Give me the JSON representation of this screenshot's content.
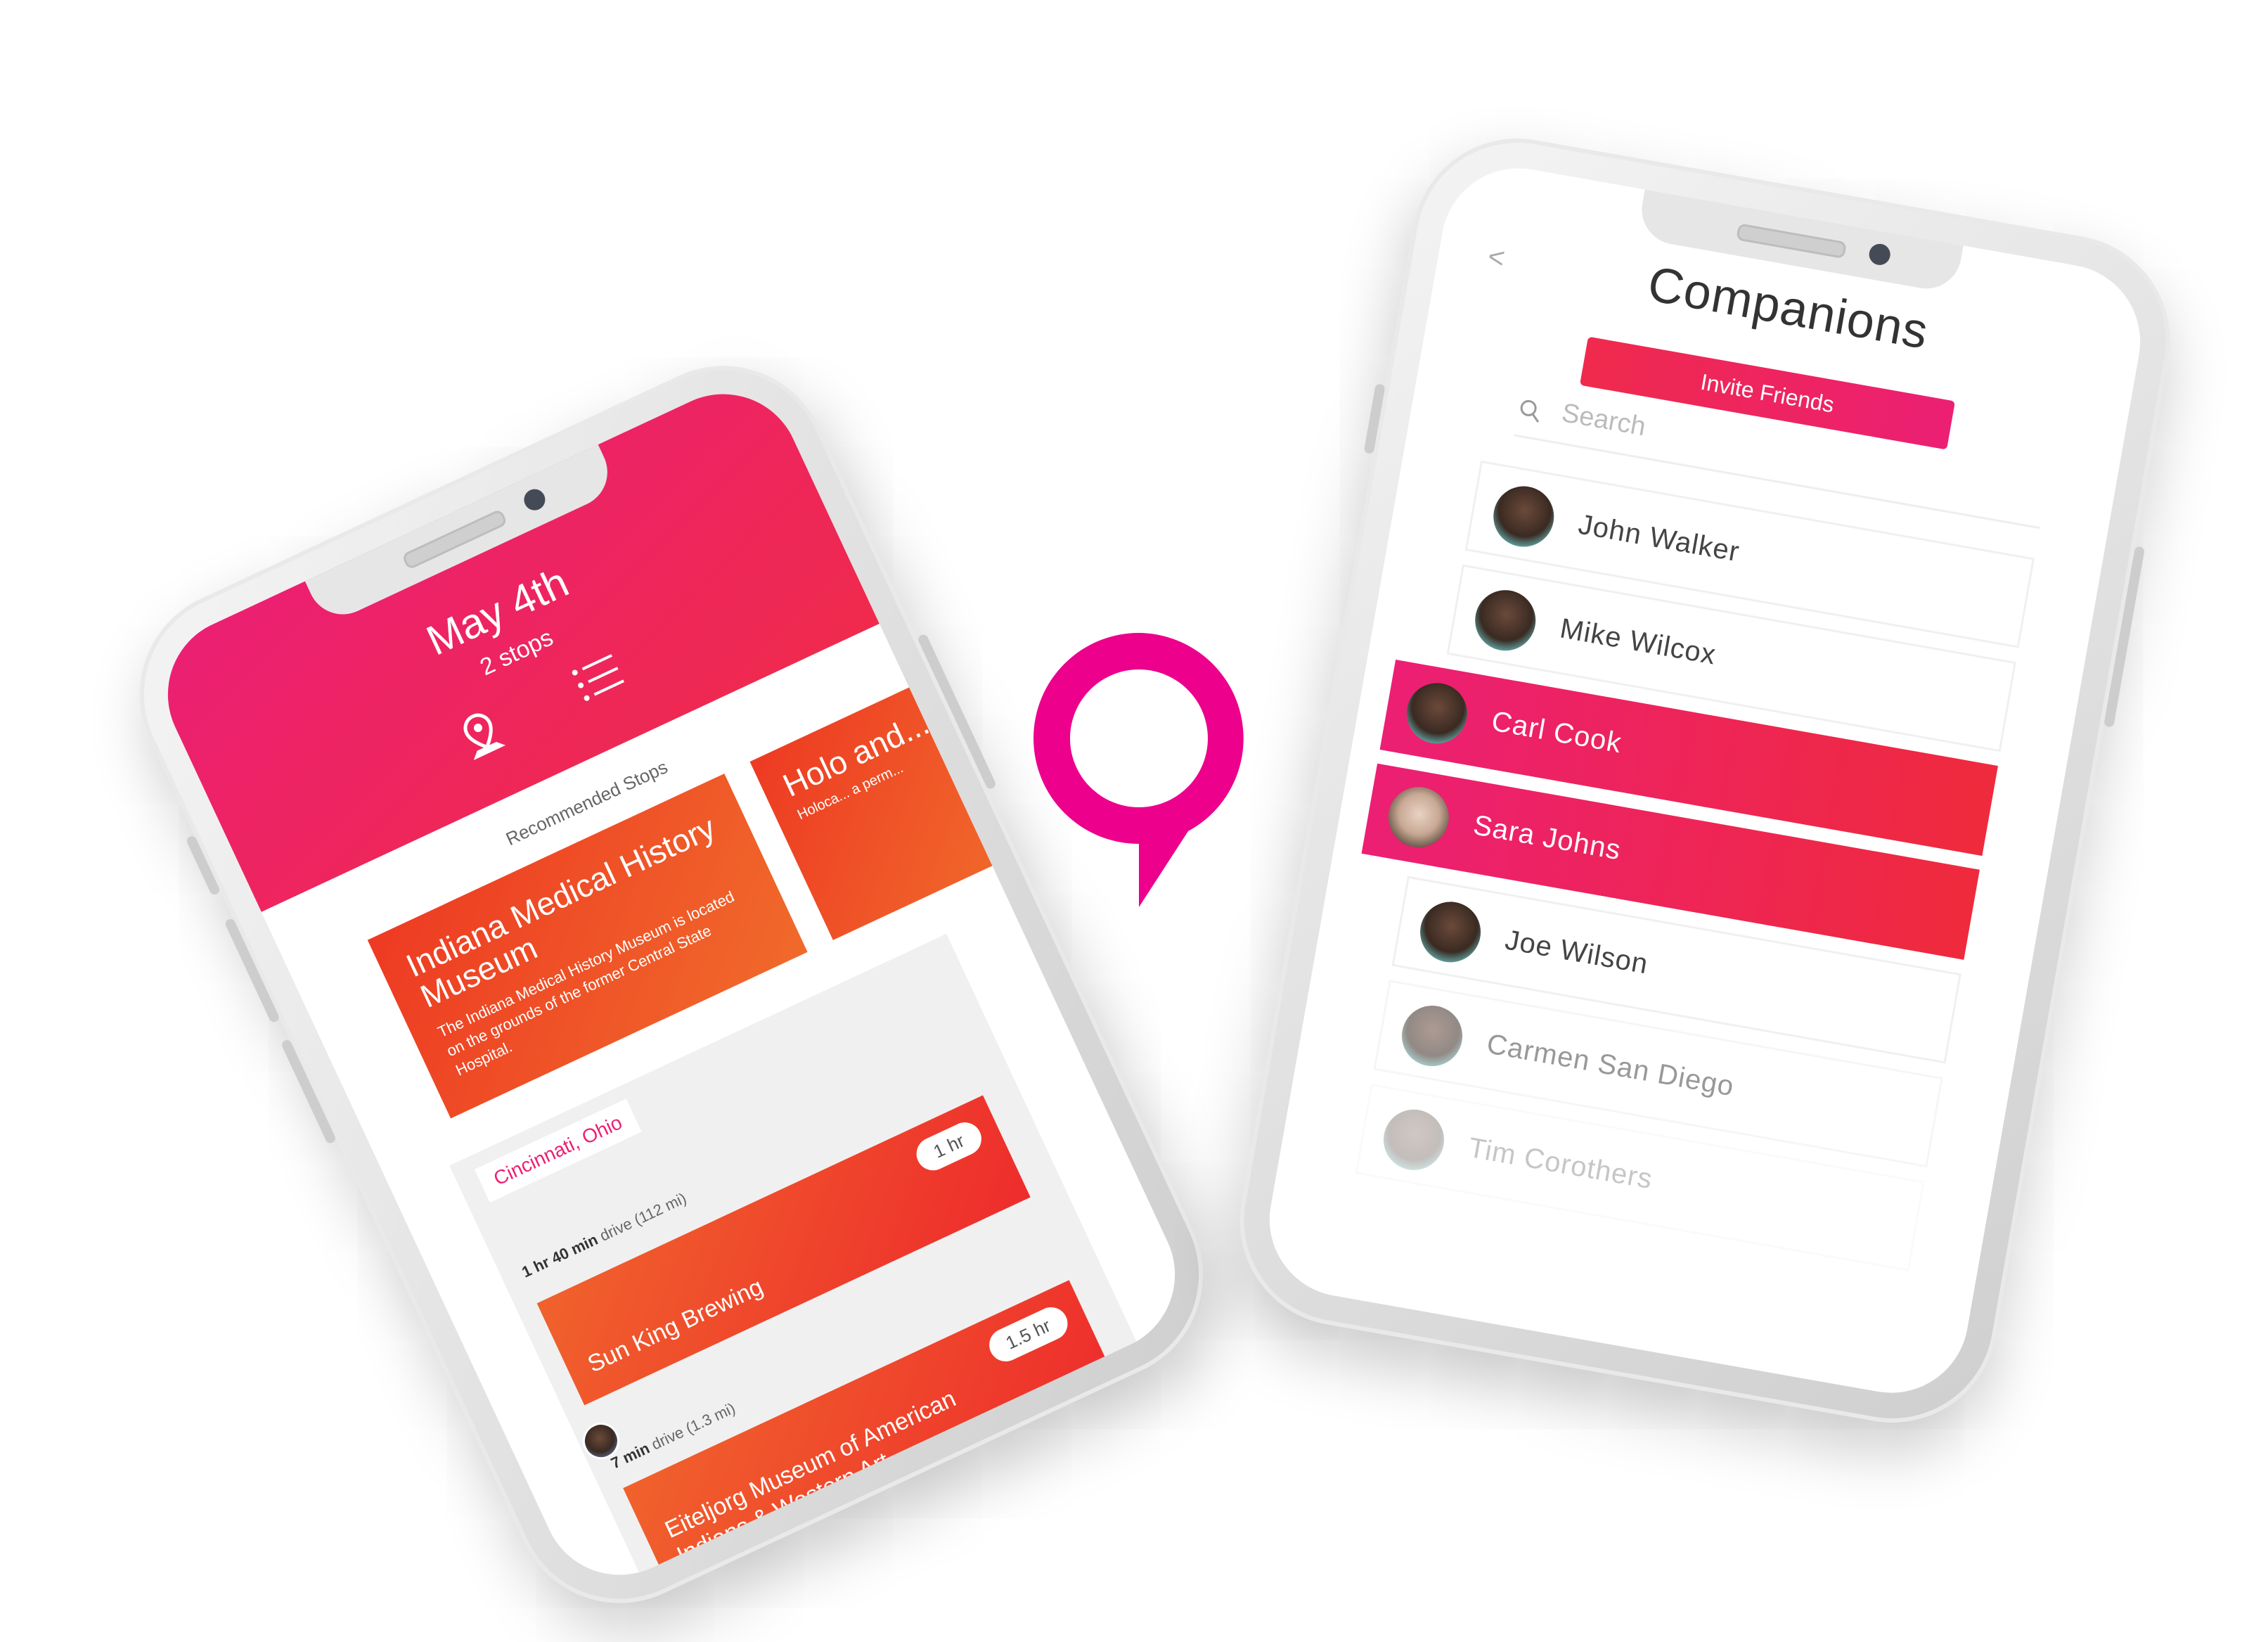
{
  "left_phone": {
    "header": {
      "date": "May 4th",
      "stops": "2 stops",
      "map_icon": "map-pin-icon",
      "list_icon": "list-icon"
    },
    "recommended_label": "Recommended Stops",
    "cards": [
      {
        "title": "Indiana Medical History Museum",
        "description": "The Indiana Medical History Museum is located on the grounds of the former Central State Hospital."
      },
      {
        "title": "Holo and...",
        "description": "Holoca... a perm..."
      }
    ],
    "timeline": {
      "city": "Cincinnati, Ohio",
      "drive1_time": "1 hr 40 min",
      "drive1_rest": " drive (112 mi)",
      "stop1_name": "Sun King Brewing",
      "stop1_duration": "1 hr",
      "drive2_time": "7 min",
      "drive2_rest": " drive (1.3 mi)",
      "stop2_name": "Eiteljorg Museum of American Indians & Western Art",
      "stop2_duration": "1.5 hr"
    }
  },
  "logo": {
    "icon": "location-pin-logo-icon",
    "color": "#ec008c"
  },
  "right_phone": {
    "back_icon": "<",
    "title": "Companions",
    "invite_label": "Invite Friends",
    "search": {
      "placeholder": "Search",
      "icon": "search-icon"
    },
    "companions": [
      {
        "name": "John Walker",
        "selected": false
      },
      {
        "name": "Mike Wilcox",
        "selected": false
      },
      {
        "name": "Carl Cook",
        "selected": true
      },
      {
        "name": "Sara Johns",
        "selected": true
      },
      {
        "name": "Joe Wilson",
        "selected": false
      },
      {
        "name": "Carmen San Diego",
        "selected": false
      },
      {
        "name": "Tim Corothers",
        "selected": false
      }
    ]
  },
  "colors": {
    "brand_pink": "#ec1f74",
    "brand_red": "#ef2a4c",
    "orange": "#f06a2b",
    "logo_magenta": "#ec008c"
  }
}
